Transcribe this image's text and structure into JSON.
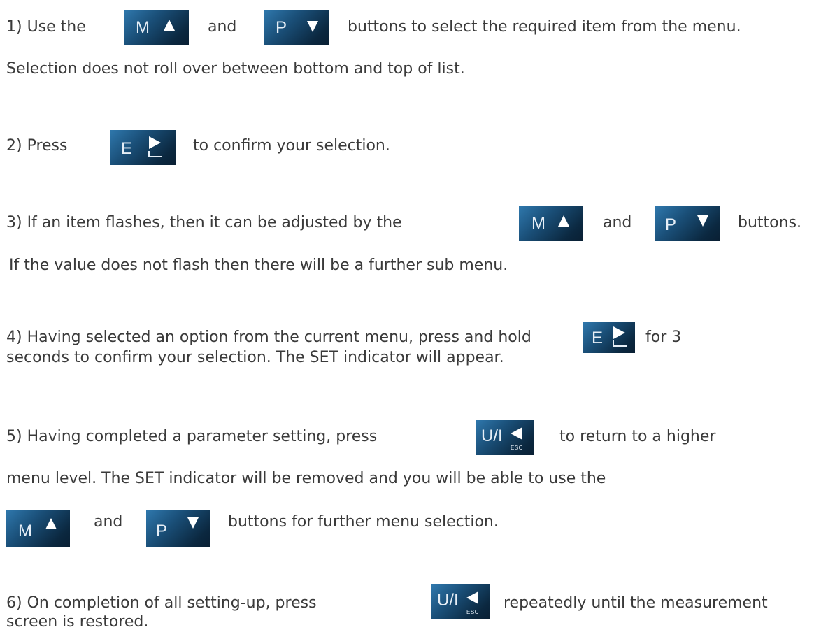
{
  "keys": {
    "m": {
      "letter": "M",
      "icon": "up-triangle-icon"
    },
    "p": {
      "letter": "P",
      "icon": "down-triangle-icon"
    },
    "e": {
      "letter": "E",
      "icon": "right-triangle-enter-icon"
    },
    "u": {
      "letter": "U/I",
      "sub": "ESC",
      "icon": "left-triangle-icon"
    }
  },
  "steps": {
    "s1": {
      "a": "1) Use the",
      "and": "and",
      "b": "buttons to select the required item from the menu.",
      "line2": "Selection does not roll over between bottom and top of list."
    },
    "s2": {
      "a": "2) Press",
      "b": "to confirm your selection."
    },
    "s3": {
      "a": "3) If an item flashes, then it can be adjusted by the",
      "and": "and",
      "b": "buttons.",
      "line2": "If the value does not flash then there will be a further sub menu."
    },
    "s4": {
      "a": "4) Having selected an option from the current menu, press and hold",
      "b": "for 3",
      "line2": "seconds to confirm your selection. The SET indicator will appear."
    },
    "s5": {
      "a": "5) Having completed a parameter setting, press",
      "b": "to return to a higher",
      "line2": "menu level. The SET indicator will be removed and you will be able to use the",
      "and": "and",
      "line3": "buttons for further menu selection."
    },
    "s6": {
      "a": "6) On completion of all setting-up, press",
      "b": "repeatedly until the measurement",
      "line2": "screen is restored."
    }
  }
}
